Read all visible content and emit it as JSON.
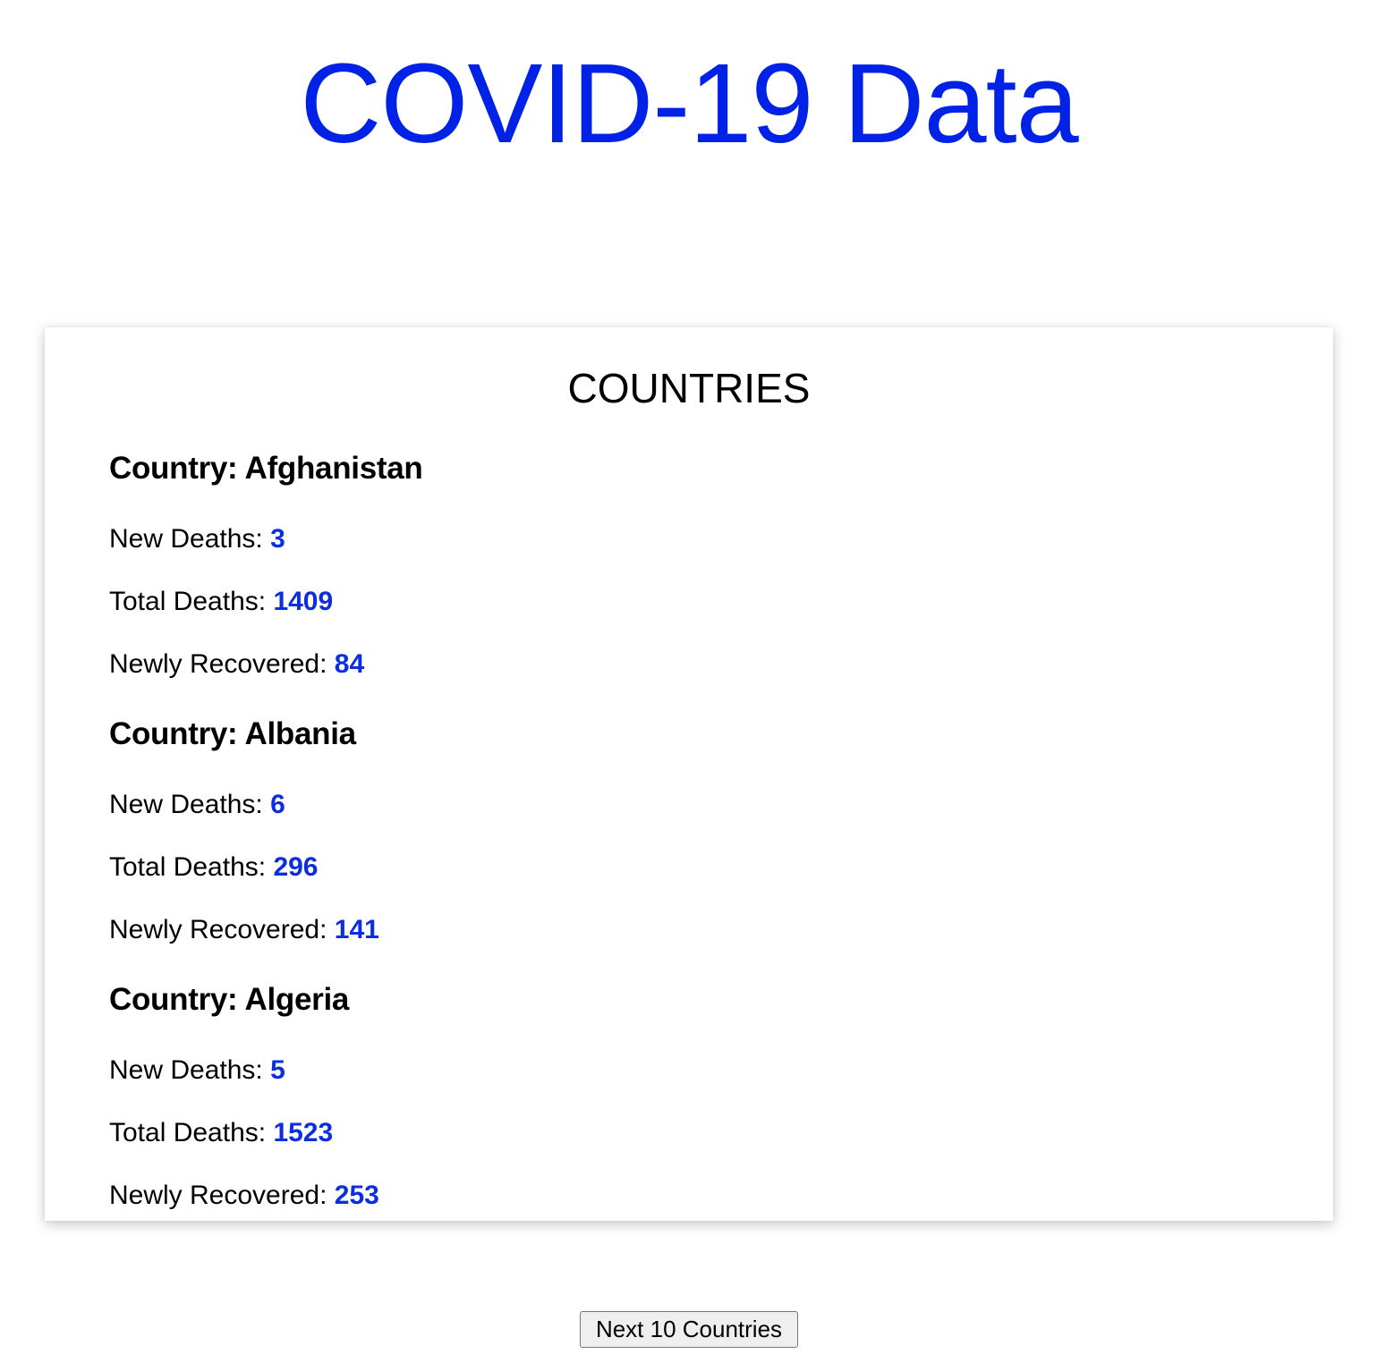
{
  "page": {
    "title": "COVID-19 Data"
  },
  "card": {
    "title": "COUNTRIES",
    "countries": [
      {
        "name": "Country: Afghanistan",
        "new_deaths_label": "New Deaths: ",
        "new_deaths": "3",
        "total_deaths_label": "Total Deaths: ",
        "total_deaths": "1409",
        "newly_recovered_label": "Newly Recovered: ",
        "newly_recovered": "84"
      },
      {
        "name": "Country: Albania",
        "new_deaths_label": "New Deaths: ",
        "new_deaths": "6",
        "total_deaths_label": "Total Deaths: ",
        "total_deaths": "296",
        "newly_recovered_label": "Newly Recovered: ",
        "newly_recovered": "141"
      },
      {
        "name": "Country: Algeria",
        "new_deaths_label": "New Deaths: ",
        "new_deaths": "5",
        "total_deaths_label": "Total Deaths: ",
        "total_deaths": "1523",
        "newly_recovered_label": "Newly Recovered: ",
        "newly_recovered": "253"
      }
    ]
  },
  "pagination": {
    "next_label": "Next 10 Countries"
  },
  "colors": {
    "title": "#0022e6",
    "value": "#0a2ee0",
    "background": "#ffffff"
  }
}
